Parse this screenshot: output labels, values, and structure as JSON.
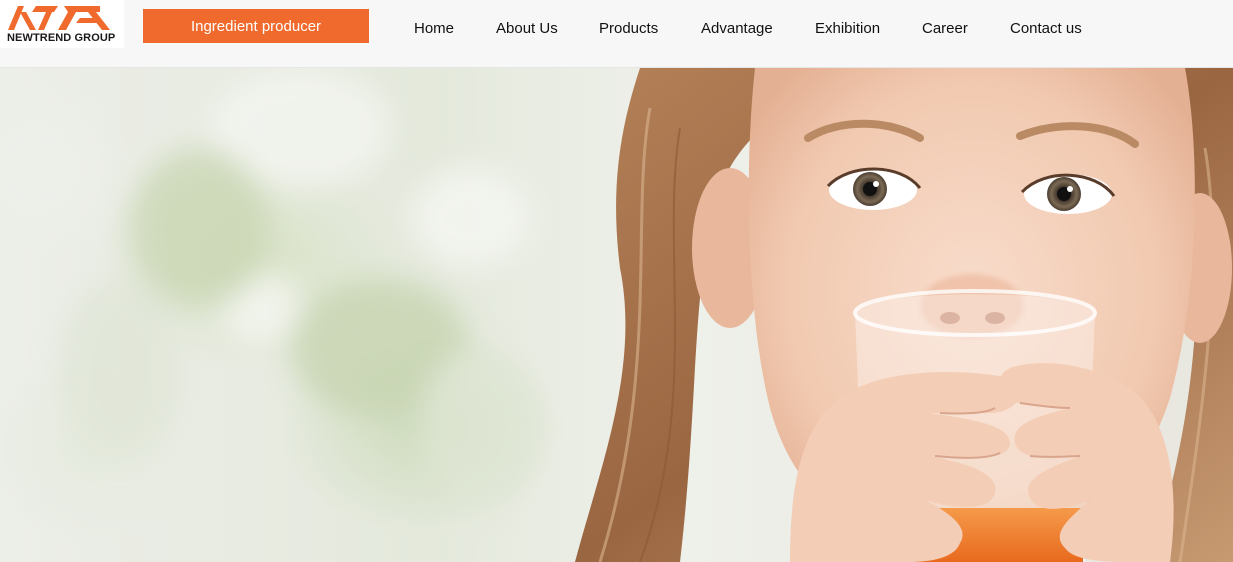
{
  "brand": {
    "name": "NEWTREND GROUP",
    "tagline": "Ingredient producer",
    "accent_color": "#ef6a2c"
  },
  "nav": {
    "items": [
      {
        "label": "Home"
      },
      {
        "label": "About Us"
      },
      {
        "label": "Products"
      },
      {
        "label": "Advantage"
      },
      {
        "label": "Exhibition"
      },
      {
        "label": "Career"
      },
      {
        "label": "Contact us"
      }
    ]
  },
  "hero": {
    "image": "girl-drinking-orange-juice"
  }
}
